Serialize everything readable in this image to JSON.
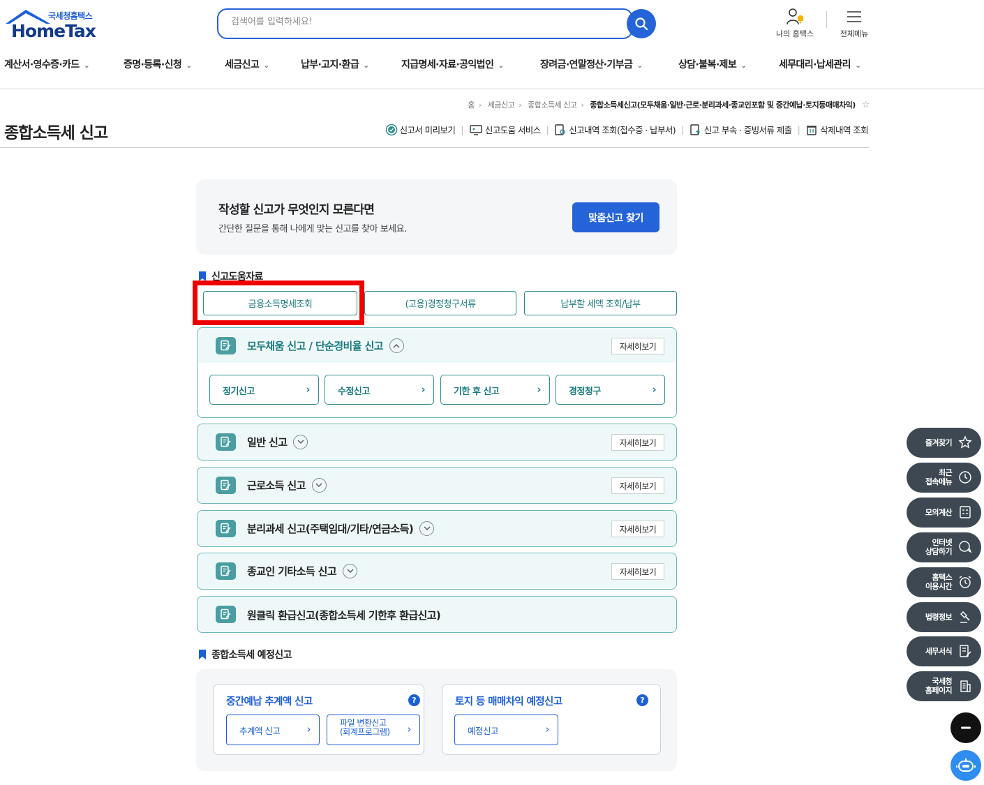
{
  "header": {
    "logo_sub": "국세청홈택스",
    "logo_main": "HomeTax",
    "search_placeholder": "검색어를 입력하세요!",
    "my_hometax": "나의 홈택스",
    "all_menu": "전체메뉴"
  },
  "gnb": [
    "계산서·영수증·카드",
    "증명·등록·신청",
    "세금신고",
    "납부·고지·환급",
    "지급명세·자료·공익법인",
    "장려금·연말정산·기부금",
    "상담·불복·제보",
    "세무대리·납세관리"
  ],
  "breadcrumb": {
    "home": "홈",
    "level1": "세금신고",
    "level2": "종합소득세 신고",
    "current": "종합소득세신고(모두채움·일반·근로·분리과세·종교인포함 및 중간예납·토지등매매차익)"
  },
  "page_title": "종합소득세 신고",
  "quick_links": [
    "신고서 미리보기",
    "신고도움 서비스",
    "신고내역 조회(접수증 · 납부서)",
    "신고 부속 · 증빙서류 제출",
    "삭제내역 조회"
  ],
  "finder": {
    "title": "작성할 신고가 무엇인지 모른다면",
    "desc": "간단한 질문을 통해 나에게 맞는 신고를 찾아 보세요.",
    "button": "맞춤신고 찾기"
  },
  "help_section": {
    "label": "신고도움자료",
    "buttons": [
      "금융소득명세조회",
      "(고용)경정청구서류",
      "납부할 세액 조회/납부"
    ]
  },
  "accordion": {
    "detail_label": "자세히보기",
    "items": [
      {
        "title": "모두채움 신고 / 단순경비율 신고"
      },
      {
        "title": "일반 신고"
      },
      {
        "title": "근로소득 신고"
      },
      {
        "title": "분리과세 신고(주택임대/기타/연금소득)"
      },
      {
        "title": "종교인 기타소득 신고"
      },
      {
        "title": "원클릭 환급신고(종합소득세 기한후 환급신고)"
      }
    ],
    "sub_buttons": [
      "정기신고",
      "수정신고",
      "기한 후 신고",
      "경정청구"
    ]
  },
  "predict_section": {
    "label": "종합소득세 예정신고",
    "card1": {
      "title": "중간예납 추계액 신고",
      "btn1": "추계액 신고",
      "btn2_line1": "파일 변환신고",
      "btn2_line2": "(회계프로그램)"
    },
    "card2": {
      "title": "토지 등 매매차익 예정신고",
      "btn1": "예정신고"
    }
  },
  "quick_menu": {
    "favorites": "즐겨찾기",
    "recent_l1": "최근",
    "recent_l2": "접속메뉴",
    "mock_calc": "모의계산",
    "consult_l1": "인터넷",
    "consult_l2": "상담하기",
    "hours_l1": "홈택스",
    "hours_l2": "이용시간",
    "law": "법령정보",
    "forms": "세무서식",
    "nts_l1": "국세청",
    "nts_l2": "홈페이지"
  },
  "colors": {
    "primary_blue": "#2563d8",
    "teal": "#2f8c8f",
    "highlight_red": "#ee0000",
    "quick_menu_bg": "#3d4852"
  }
}
